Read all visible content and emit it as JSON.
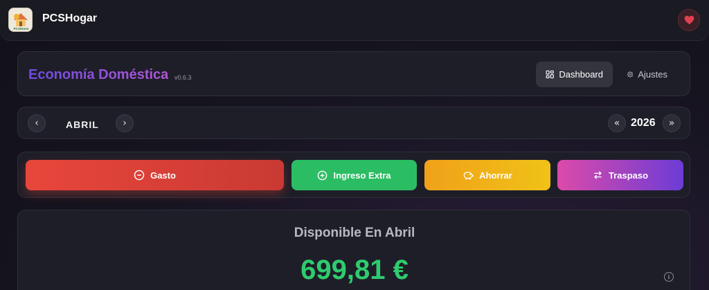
{
  "topbar": {
    "app_name": "PCSHogar",
    "logo_text": "PCSHome"
  },
  "header": {
    "title": "Economía Doméstica",
    "version": "v0.6.3",
    "nav": [
      {
        "label": "Dashboard",
        "icon": "dashboard-icon",
        "active": true
      },
      {
        "label": "Ajustes",
        "icon": "gear-icon",
        "active": false
      }
    ]
  },
  "month_nav": {
    "prev_month": "‹",
    "month": "ABRIL",
    "next_month": "›",
    "prev_year": "«",
    "year": "2026",
    "next_year": "»"
  },
  "actions": [
    {
      "label": "Gasto",
      "icon": "minus-circle-icon",
      "color": "#e8463b"
    },
    {
      "label": "Ingreso Extra",
      "icon": "plus-circle-icon",
      "color": "#2bbd63"
    },
    {
      "label": "Ahorrar",
      "icon": "piggy-bank-icon",
      "color": "#f0a119"
    },
    {
      "label": "Traspaso",
      "icon": "transfer-icon",
      "color": "#dc4aa9"
    }
  ],
  "summary": {
    "title": "Disponible En Abril",
    "amount": "699,81 €",
    "amount_color": "#2ecc6e",
    "info_icon_glyph": "i"
  },
  "colors": {
    "accent_start": "#6d4be0",
    "accent_end": "#b357d6",
    "favorite": "#e0404f"
  }
}
